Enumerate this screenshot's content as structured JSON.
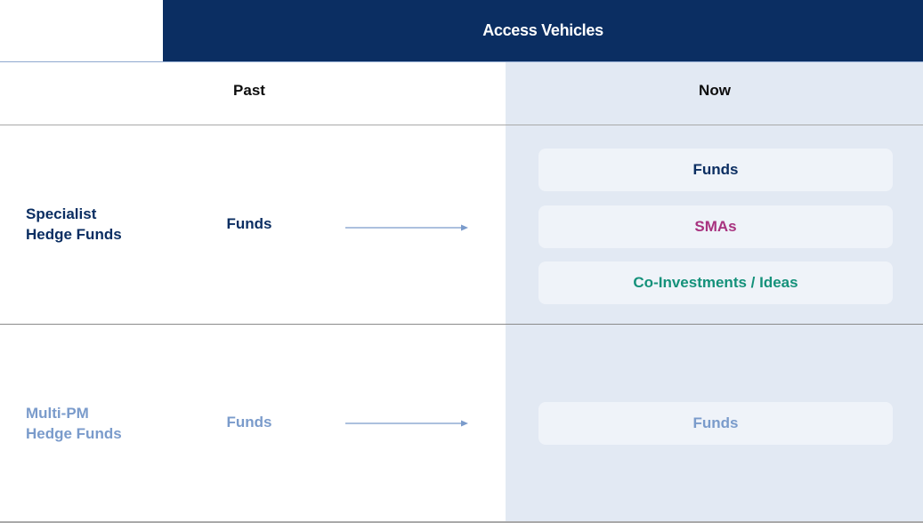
{
  "header": {
    "title": "Access Vehicles"
  },
  "columns": {
    "past": "Past",
    "now": "Now"
  },
  "colors": {
    "navy": "#0b2e62",
    "muted_blue": "#7a9bcb",
    "magenta": "#a8327f",
    "teal": "#14917a",
    "now_background": "#e2e9f3"
  },
  "rows": [
    {
      "label_line1": "Specialist",
      "label_line2": "Hedge Funds",
      "past": "Funds",
      "now": [
        "Funds",
        "SMAs",
        "Co-Investments / Ideas"
      ]
    },
    {
      "label_line1": "Multi-PM",
      "label_line2": "Hedge Funds",
      "past": "Funds",
      "now": [
        "Funds"
      ]
    }
  ]
}
